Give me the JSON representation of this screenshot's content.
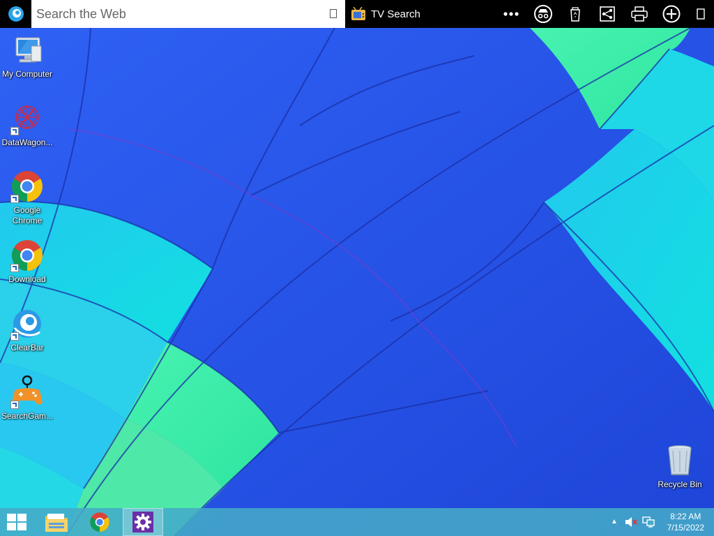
{
  "toolbar": {
    "search_placeholder": "Search the Web",
    "tv_search_label": "TV Search",
    "buttons": [
      "more-icon",
      "incognito-icon",
      "recycle-bag-icon",
      "share-icon",
      "print-icon",
      "add-icon",
      "square-icon"
    ]
  },
  "desktop": {
    "icons": [
      {
        "label": "My Computer"
      },
      {
        "label": "DataWagon..."
      },
      {
        "label": "Google Chrome"
      },
      {
        "label": "Download"
      },
      {
        "label": "ClearBar"
      },
      {
        "label": "SearchGam..."
      },
      {
        "label": "Recycle Bin"
      }
    ]
  },
  "taskbar": {
    "time": "8:22 AM",
    "date": "7/15/2022"
  },
  "colors": {
    "balloon_blue": "#2a5cf0",
    "balloon_cyan": "#1fd6e8",
    "balloon_green": "#3ef0a0",
    "taskbar": "#46aac8"
  }
}
